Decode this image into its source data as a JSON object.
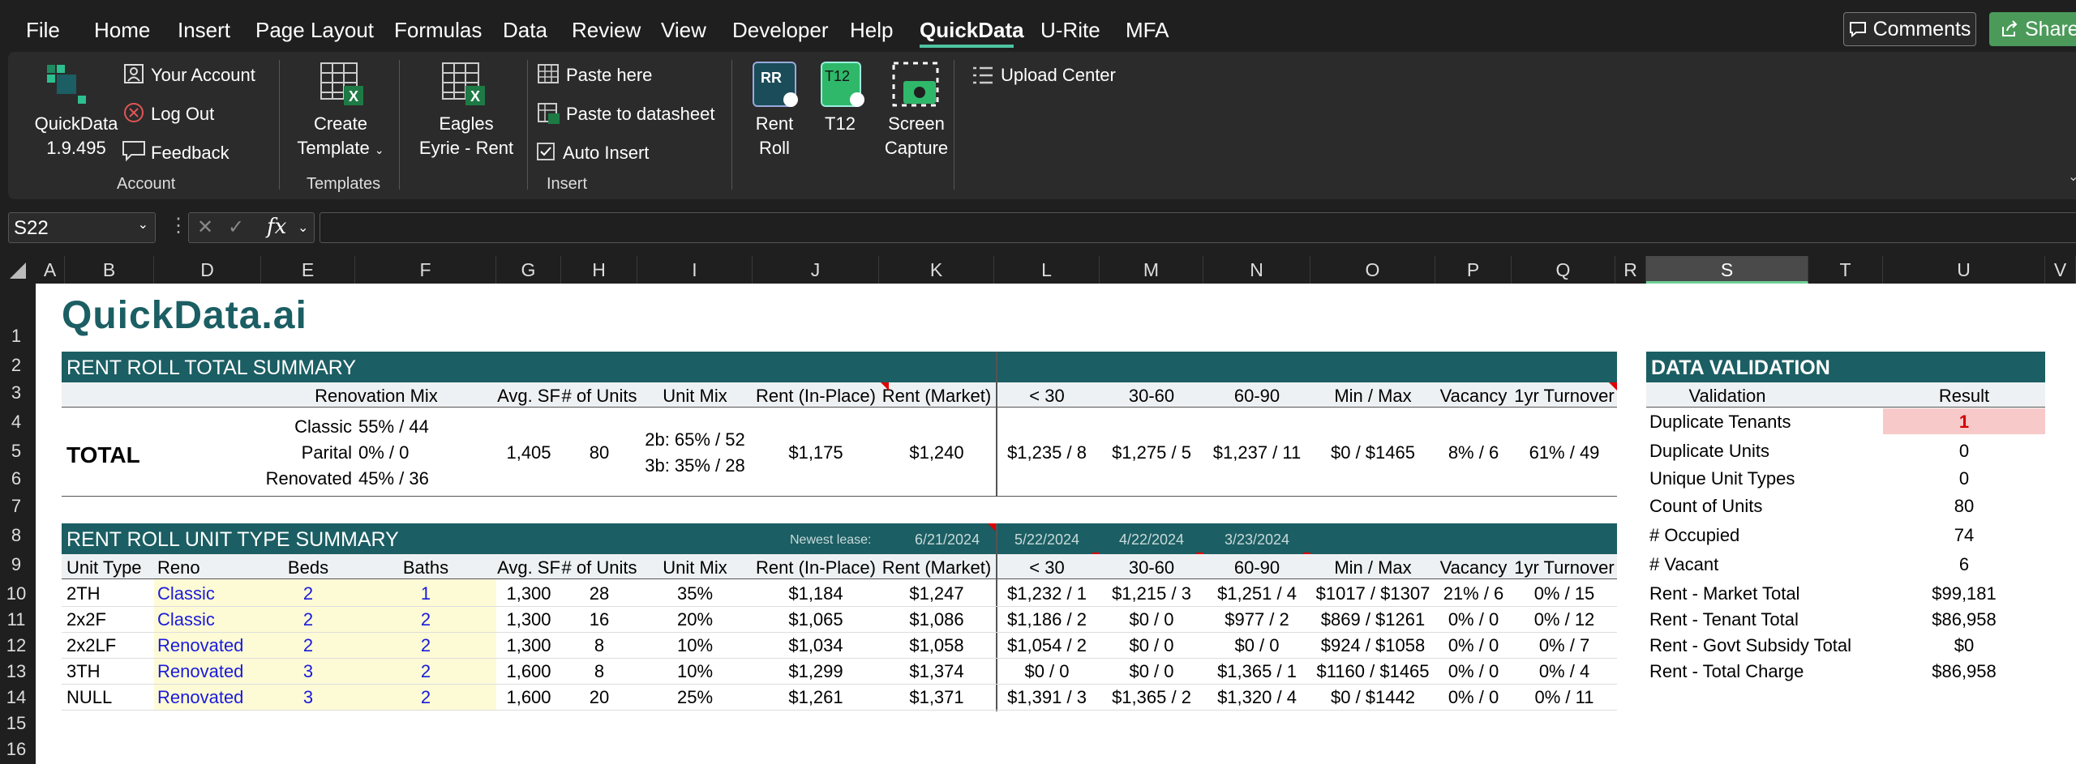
{
  "menu": {
    "items": [
      "File",
      "Home",
      "Insert",
      "Page Layout",
      "Formulas",
      "Data",
      "Review",
      "View",
      "Developer",
      "Help",
      "QuickData",
      "U-Rite",
      "MFA"
    ],
    "active": "QuickData",
    "comments": "Comments",
    "share": "Share"
  },
  "ribbon": {
    "quickdata": "QuickData",
    "version": "1.9.495",
    "your_account": "Your Account",
    "log_out": "Log Out",
    "feedback": "Feedback",
    "account_group": "Account",
    "create": "Create",
    "template": "Template",
    "templates_group": "Templates",
    "eagles": "Eagles",
    "eyrie_rent": "Eyrie - Rent",
    "paste_here": "Paste here",
    "paste_to_datasheet": "Paste to datasheet",
    "auto_insert": "Auto Insert",
    "insert_group": "Insert",
    "rent": "Rent",
    "roll": "Roll",
    "rr_icon_text": "RR",
    "t12": "T12",
    "screen": "Screen",
    "capture": "Capture",
    "upload_center": "Upload Center"
  },
  "formula_bar": {
    "name_box": "S22",
    "fx": "fx"
  },
  "columns": [
    "A",
    "B",
    "D",
    "E",
    "F",
    "G",
    "H",
    "I",
    "J",
    "K",
    "L",
    "M",
    "N",
    "O",
    "P",
    "Q",
    "R",
    "S",
    "T",
    "U",
    "V"
  ],
  "selected_column": "S",
  "rows": [
    "1",
    "2",
    "3",
    "4",
    "5",
    "6",
    "7",
    "8",
    "9",
    "10",
    "11",
    "12",
    "13",
    "14",
    "15",
    "16"
  ],
  "logo": "QuickData.ai",
  "total_summary": {
    "title": "RENT ROLL TOTAL SUMMARY",
    "headers": {
      "renovation_mix": "Renovation Mix",
      "avg_sf": "Avg. SF",
      "num_units": "# of Units",
      "unit_mix": "Unit Mix",
      "rent_inplace": "Rent (In-Place)",
      "rent_market": "Rent (Market)",
      "lt30": "< 30",
      "d30_60": "30-60",
      "d60_90": "60-90",
      "minmax": "Min / Max",
      "vacancy": "Vacancy",
      "turnover": "1yr Turnover"
    },
    "total_label": "TOTAL",
    "reno": [
      {
        "label": "Classic",
        "value": "55% / 44"
      },
      {
        "label": "Parital",
        "value": "0% / 0"
      },
      {
        "label": "Renovated",
        "value": "45% / 36"
      }
    ],
    "avg_sf": "1,405",
    "num_units": "80",
    "unit_mix_1": "2b: 65% / 52",
    "unit_mix_2": "3b: 35% / 28",
    "rent_inplace": "$1,175",
    "rent_market": "$1,240",
    "lt30": "$1,235 / 8",
    "d30_60": "$1,275 / 5",
    "d60_90": "$1,237 / 11",
    "minmax": "$0 / $1465",
    "vacancy": "8% / 6",
    "turnover": "61% / 49"
  },
  "unit_summary": {
    "title": "RENT ROLL UNIT TYPE SUMMARY",
    "newest_lease_label": "Newest lease:",
    "newest_lease": "6/21/2024",
    "date_l": "5/22/2024",
    "date_m": "4/22/2024",
    "date_n": "3/23/2024",
    "headers": [
      "Unit Type",
      "Reno",
      "Beds",
      "Baths",
      "Avg. SF",
      "# of Units",
      "Unit Mix",
      "Rent (In-Place)",
      "Rent (Market)",
      "< 30",
      "30-60",
      "60-90",
      "Min / Max",
      "Vacancy",
      "1yr Turnover"
    ],
    "rows": [
      [
        "2TH",
        "Classic",
        "2",
        "1",
        "1,300",
        "28",
        "35%",
        "$1,184",
        "$1,247",
        "$1,232 / 1",
        "$1,215 / 3",
        "$1,251 / 4",
        "$1017 / $1307",
        "21% / 6",
        "0% / 15"
      ],
      [
        "2x2F",
        "Classic",
        "2",
        "2",
        "1,300",
        "16",
        "20%",
        "$1,065",
        "$1,086",
        "$1,186 / 2",
        "$0 / 0",
        "$977 / 2",
        "$869 / $1261",
        "0% / 0",
        "0% / 12"
      ],
      [
        "2x2LF",
        "Renovated",
        "2",
        "2",
        "1,300",
        "8",
        "10%",
        "$1,034",
        "$1,058",
        "$1,054 / 2",
        "$0 / 0",
        "$0 / 0",
        "$924 / $1058",
        "0% / 0",
        "0% / 7"
      ],
      [
        "3TH",
        "Renovated",
        "3",
        "2",
        "1,600",
        "8",
        "10%",
        "$1,299",
        "$1,374",
        "$0 / 0",
        "$0 / 0",
        "$1,365 / 1",
        "$1160 / $1465",
        "0% / 0",
        "0% / 4"
      ],
      [
        "NULL",
        "Renovated",
        "3",
        "2",
        "1,600",
        "20",
        "25%",
        "$1,261",
        "$1,371",
        "$1,391 / 3",
        "$1,365 / 2",
        "$1,320 / 4",
        "$0 / $1442",
        "0% / 0",
        "0% / 11"
      ]
    ]
  },
  "validation": {
    "title": "DATA VALIDATION",
    "col_validation": "Validation",
    "col_result": "Result",
    "rows": [
      [
        "Duplicate Tenants",
        "1"
      ],
      [
        "Duplicate Units",
        "0"
      ],
      [
        "Unique Unit Types",
        "0"
      ],
      [
        "Count of Units",
        "80"
      ],
      [
        "# Occupied",
        "74"
      ],
      [
        "# Vacant",
        "6"
      ],
      [
        "Rent - Market Total",
        "$99,181"
      ],
      [
        "Rent - Tenant Total",
        "$86,958"
      ],
      [
        "Rent - Govt Subsidy Total",
        "$0"
      ],
      [
        "Rent - Total Charge",
        "$86,958"
      ]
    ],
    "highlight_color": "#f8c9c9",
    "highlight_text_color": "#d00000"
  },
  "colors": {
    "header_band": "#1b5e63",
    "blue_text": "#1a1adb",
    "yellow_fill": "#fdfbd6",
    "accent": "#4fc3a1"
  }
}
